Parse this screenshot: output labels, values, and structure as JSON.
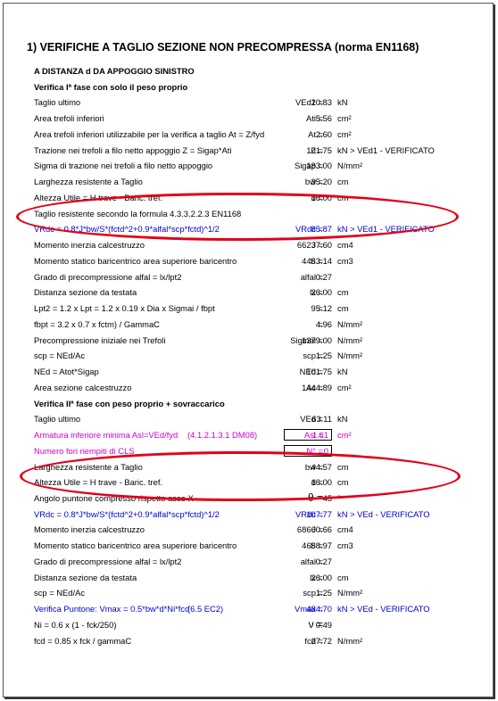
{
  "title": "1) VERIFICHE A  TAGLIO SEZIONE NON PRECOMPRESSA (norma EN1168)",
  "rows": [
    {
      "label": "A DISTANZA d DA APPOGGIO SINISTRO",
      "symbol": "",
      "value": "",
      "unit": "",
      "style": "section"
    },
    {
      "label": "Verifica Iª fase con solo il peso proprio",
      "symbol": "",
      "value": "",
      "unit": "",
      "style": "section"
    },
    {
      "label": "Taglio ultimo",
      "symbol": "VEd1 =",
      "value": "20.83",
      "unit": "kN",
      "style": ""
    },
    {
      "label": "Area trefoli inferiori",
      "symbol": "Ati =",
      "value": "5.56",
      "unit": "cm²",
      "style": ""
    },
    {
      "label": "Area trefoli inferiori utilizzabile per la verifica a taglio At = Z/fyd",
      "symbol": "At =",
      "value": "2.60",
      "unit": "cm²",
      "style": ""
    },
    {
      "label": "Trazione nei trefoli a filo netto appoggio Z = Sigap*Ati",
      "symbol": "Z =",
      "value": "101.75",
      "unit": "kN > VEd1 - VERIFICATO",
      "style": ""
    },
    {
      "label": "Sigma di trazione nei trefoli a filo netto appoggio",
      "symbol": "Sigap =",
      "value": "183.00",
      "unit": "N/mm²",
      "style": ""
    },
    {
      "label": "Larghezza resistente a Taglio",
      "symbol": "bw =",
      "value": "35.20",
      "unit": "cm",
      "style": ""
    },
    {
      "label": "Altezza Utile = H trave - Baric. tref.",
      "symbol": "d =",
      "value": "16.00",
      "unit": "cm",
      "style": ""
    },
    {
      "label": "Taglio resistente secondo la formula 4.3.3.2.2.3 EN1168",
      "symbol": "",
      "value": "",
      "unit": "",
      "style": ""
    },
    {
      "label": "VRdc = 0.8*J*bw/S*(fctd^2+0.9*alfal*scp*fctd)^1/2",
      "symbol": "VRdc =",
      "value": "85.87",
      "unit": "kN > VEd1 - VERIFICATO",
      "style": "blue"
    },
    {
      "label": "Momento inerzia calcestruzzo",
      "symbol": "J =",
      "value": "66237.60",
      "unit": "cm4",
      "style": ""
    },
    {
      "label": "Momento statico baricentrico area superiore baricentro",
      "symbol": "S =",
      "value": "4483.14",
      "unit": "cm3",
      "style": ""
    },
    {
      "label": "Grado di precompressione alfal = lx/lpt2",
      "symbol": "alfal =",
      "value": "0.27",
      "unit": "",
      "style": ""
    },
    {
      "label": "Distanza sezione da testata",
      "symbol": "lx =",
      "value": "26.00",
      "unit": "cm",
      "style": ""
    },
    {
      "label": "Lpt2 = 1.2 x Lpt = 1.2 x 0.19 x Dia x Sigmai / fbpt",
      "symbol": "=",
      "value": "95.12",
      "unit": "cm",
      "style": ""
    },
    {
      "label": "fbpt = 3.2 x 0.7 x fctm) / GammaC",
      "symbol": "=",
      "value": "4.96",
      "unit": "N/mm²",
      "style": ""
    },
    {
      "label": "Precompressione iniziale nei Trefoli",
      "symbol": "Sigmai =",
      "value": "1379.00",
      "unit": "N/mm²",
      "style": ""
    },
    {
      "label": "scp = NEd/Ac",
      "symbol": "scp =",
      "value": "1.25",
      "unit": "N/mm²",
      "style": ""
    },
    {
      "label": "NEd = Atot*Sigap",
      "symbol": "NEd =",
      "value": "101.75",
      "unit": "kN",
      "style": ""
    },
    {
      "label": "Area sezione calcestruzzo",
      "symbol": "Ac =",
      "value": "1444.89",
      "unit": "cm²",
      "style": ""
    },
    {
      "label": "Verifica IIª fase con peso proprio + sovraccarico",
      "symbol": "",
      "value": "",
      "unit": "",
      "style": "section"
    },
    {
      "label": "Taglio ultimo",
      "symbol": "VEd =",
      "value": "63.11",
      "unit": "kN",
      "style": ""
    },
    {
      "label": "Armatura inferiore minima Asl=VEd/fyd",
      "note": "(4.1.2.1.3.1 DM08)",
      "symbol": "Asl =",
      "value": "1.61",
      "unit": "cm²",
      "style": "mag boxed"
    },
    {
      "label": "Numero fori riempiti di CLS",
      "symbol": "N° =",
      "value": "0",
      "unit": "",
      "style": "mag boxed"
    },
    {
      "label": "Larghezza resistente a Taglio",
      "symbol": "bw =",
      "value": "44.57",
      "unit": "cm",
      "style": ""
    },
    {
      "label": "Altezza Utile = H trave - Baric. tref.",
      "symbol": "d =",
      "value": "16.00",
      "unit": "cm",
      "style": ""
    },
    {
      "label": "Angolo puntone compresso rispetto asse X",
      "symbol": "θ =",
      "value": "45",
      "unit": "°",
      "style": "bigsym"
    },
    {
      "label": "VRdc = 0.8*J*bw/S*(fctd^2+0.9*alfal*scp*fctd)^1/2",
      "symbol": "VRdc =",
      "value": "107.77",
      "unit": "kN > VEd - VERIFICATO",
      "style": "blue"
    },
    {
      "label": "Momento inerzia calcestruzzo",
      "symbol": "J =",
      "value": "68660.66",
      "unit": "cm4",
      "style": ""
    },
    {
      "label": "Momento statico baricentrico area superiore baricentro",
      "symbol": "S =",
      "value": "4688.97",
      "unit": "cm3",
      "style": ""
    },
    {
      "label": "Grado di precompressione alfal = lx/lpt2",
      "symbol": "alfal =",
      "value": "0.27",
      "unit": "",
      "style": ""
    },
    {
      "label": "Distanza sezione da testata",
      "symbol": "lx =",
      "value": "26.00",
      "unit": "cm",
      "style": ""
    },
    {
      "label": "scp = NEd/Ac",
      "symbol": "scp =",
      "value": "1.25",
      "unit": "N/mm²",
      "style": ""
    },
    {
      "label": "Verifica Puntone: Vmax = 0.5*bw*d*Ni*fcd",
      "note": "(6.5 EC2)",
      "symbol": "Vmax =",
      "value": "484.70",
      "unit": "kN > VEd - VERIFICATO",
      "style": "blue"
    },
    {
      "label": "Ni = 0.6 x (1 - fck/250)",
      "symbol": "ν =",
      "value": "0.49",
      "unit": "",
      "style": "bigsym"
    },
    {
      "label": "fcd = 0.85 x fck / gammaC",
      "symbol": "fcd =",
      "value": "27.72",
      "unit": "N/mm²",
      "style": ""
    }
  ]
}
